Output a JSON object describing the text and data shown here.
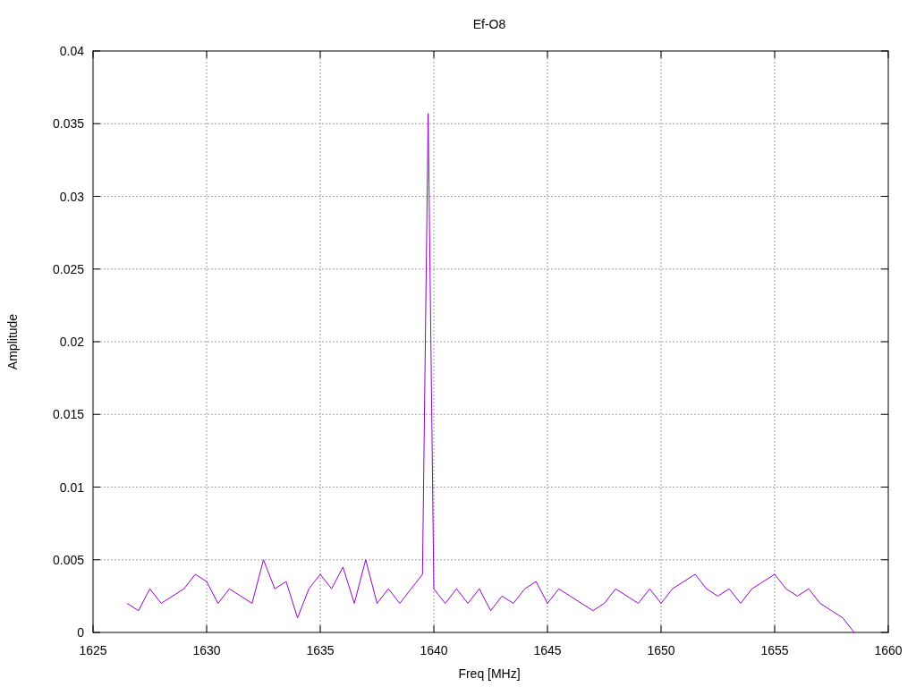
{
  "chart_data": {
    "type": "line",
    "title": "Ef-O8",
    "xlabel": "Freq [MHz]",
    "ylabel": "Amplitude",
    "x": [
      1626.5,
      1627,
      1627.5,
      1628,
      1628.5,
      1629,
      1629.5,
      1630,
      1630.5,
      1631,
      1631.5,
      1632,
      1632.5,
      1633,
      1633.5,
      1634,
      1634.5,
      1635,
      1635.5,
      1636,
      1636.5,
      1637,
      1637.5,
      1638,
      1638.5,
      1639,
      1639.5,
      1639.75,
      1640,
      1640.5,
      1641,
      1641.5,
      1642,
      1642.5,
      1643,
      1643.5,
      1644,
      1644.5,
      1645,
      1645.5,
      1646,
      1646.5,
      1647,
      1647.5,
      1648,
      1648.5,
      1649,
      1649.5,
      1650,
      1650.5,
      1651,
      1651.5,
      1652,
      1652.5,
      1653,
      1653.5,
      1654,
      1654.5,
      1655,
      1655.5,
      1656,
      1656.5,
      1657,
      1657.5,
      1658,
      1658.5
    ],
    "grid": true,
    "series": [
      {
        "color": "#9400d3",
        "values": [
          0.002,
          0.0015,
          0.003,
          0.002,
          0.0025,
          0.003,
          0.004,
          0.0035,
          0.002,
          0.003,
          0.0025,
          0.002,
          0.005,
          0.003,
          0.0035,
          0.001,
          0.003,
          0.004,
          0.003,
          0.0045,
          0.002,
          0.005,
          0.002,
          0.003,
          0.002,
          0.003,
          0.004,
          0.0357,
          0.003,
          0.002,
          0.003,
          0.002,
          0.003,
          0.0015,
          0.0025,
          0.002,
          0.003,
          0.0035,
          0.002,
          0.003,
          0.0025,
          0.002,
          0.0015,
          0.002,
          0.003,
          0.0025,
          0.002,
          0.003,
          0.002,
          0.003,
          0.0035,
          0.004,
          0.003,
          0.0025,
          0.003,
          0.002,
          0.003,
          0.0035,
          0.004,
          0.003,
          0.0025,
          0.003,
          0.002,
          0.0015,
          0.001,
          0.0
        ]
      }
    ],
    "xlim": [
      1625,
      1660
    ],
    "ylim": [
      0,
      0.04
    ],
    "xticks": [
      1625,
      1630,
      1635,
      1640,
      1645,
      1650,
      1655,
      1660
    ],
    "yticks": [
      {
        "value": 0,
        "label": "0"
      },
      {
        "value": 0.005,
        "label": "0.005"
      },
      {
        "value": 0.01,
        "label": "0.01"
      },
      {
        "value": 0.015,
        "label": "0.015"
      },
      {
        "value": 0.02,
        "label": "0.02"
      },
      {
        "value": 0.025,
        "label": "0.025"
      },
      {
        "value": 0.03,
        "label": "0.03"
      },
      {
        "value": 0.035,
        "label": "0.035"
      },
      {
        "value": 0.04,
        "label": "0.04"
      }
    ]
  }
}
